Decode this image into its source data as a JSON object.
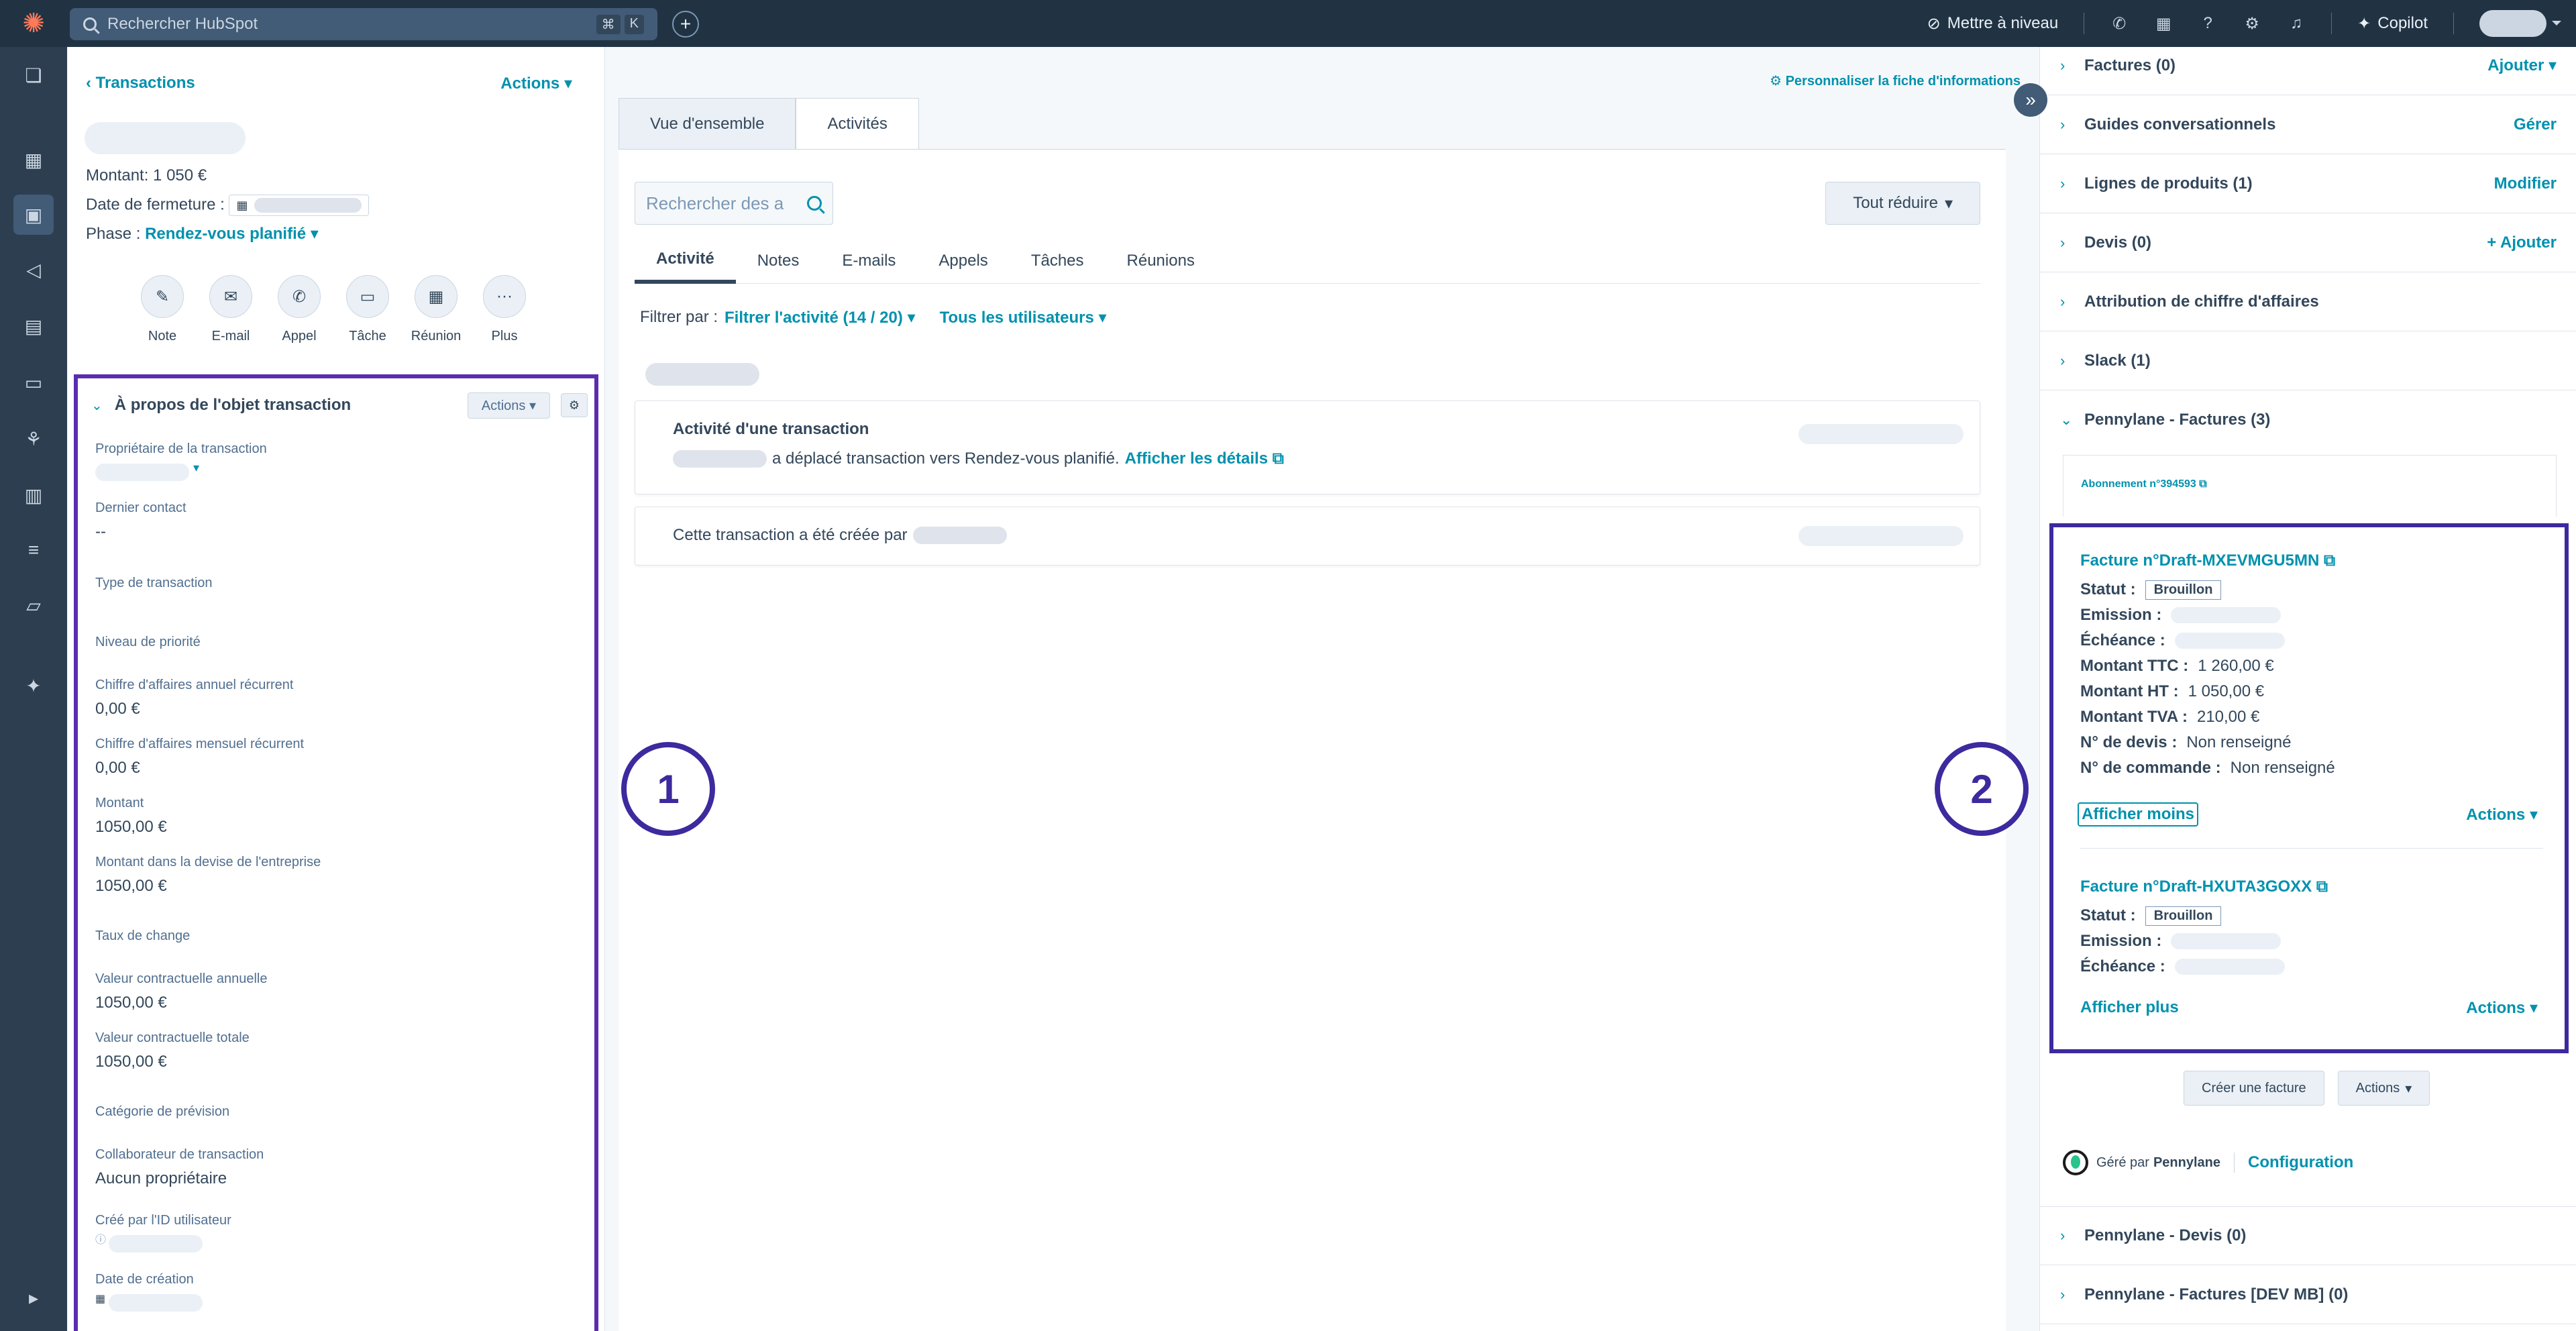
{
  "topbar": {
    "search_placeholder": "Rechercher HubSpot",
    "kbd_1": "⌘",
    "kbd_2": "K",
    "upgrade": "Mettre à niveau",
    "copilot": "Copilot"
  },
  "left": {
    "back": "Transactions",
    "actions": "Actions",
    "amount": "Montant: 1 050 €",
    "close_date_label": "Date de fermeture :",
    "phase_label": "Phase :",
    "phase_value": "Rendez-vous planifié",
    "quick_actions": {
      "note": "Note",
      "email": "E-mail",
      "call": "Appel",
      "task": "Tâche",
      "meeting": "Réunion",
      "more": "Plus"
    },
    "about": {
      "title": "À propos de l'objet transaction",
      "actions": "Actions",
      "props": [
        {
          "label": "Propriétaire de la transaction",
          "value": ""
        },
        {
          "label": "Dernier contact",
          "value": "--"
        },
        {
          "label": "Type de transaction",
          "value": ""
        },
        {
          "label": "Niveau de priorité",
          "value": ""
        },
        {
          "label": "Chiffre d'affaires annuel récurrent",
          "value": "0,00 €"
        },
        {
          "label": "Chiffre d'affaires mensuel récurrent",
          "value": "0,00 €"
        },
        {
          "label": "Montant",
          "value": "1050,00 €"
        },
        {
          "label": "Montant dans la devise de l'entreprise",
          "value": "1050,00 €"
        },
        {
          "label": "Taux de change",
          "value": ""
        },
        {
          "label": "Valeur contractuelle annuelle",
          "value": "1050,00 €"
        },
        {
          "label": "Valeur contractuelle totale",
          "value": "1050,00 €"
        },
        {
          "label": "Catégorie de prévision",
          "value": ""
        },
        {
          "label": "Collaborateur de transaction",
          "value": "Aucun propriétaire"
        },
        {
          "label": "Créé par l'ID utilisateur",
          "value": ""
        },
        {
          "label": "Date de création",
          "value": ""
        }
      ]
    }
  },
  "badges": {
    "one": "1",
    "two": "2"
  },
  "middle": {
    "personalize": "Personnaliser la fiche d'informations",
    "tabs": [
      "Vue d'ensemble",
      "Activités"
    ],
    "search_placeholder": "Rechercher des a",
    "reduce_all": "Tout réduire",
    "sub_tabs": [
      "Activité",
      "Notes",
      "E-mails",
      "Appels",
      "Tâches",
      "Réunions"
    ],
    "filter_label": "Filtrer par :",
    "filter_activity": "Filtrer l'activité (14 / 20)",
    "filter_users": "Tous les utilisateurs",
    "card1_title": "Activité d'une transaction",
    "card1_text": "a déplacé transaction vers Rendez-vous planifié.",
    "card1_link": "Afficher les détails",
    "card2_text": "Cette transaction a été créée par"
  },
  "right": {
    "sections": [
      {
        "title": "Factures (0)",
        "action": "Ajouter"
      },
      {
        "title": "Guides conversationnels",
        "action": "Gérer"
      },
      {
        "title": "Lignes de produits (1)",
        "action": "Modifier"
      },
      {
        "title": "Devis (0)",
        "action": "+ Ajouter"
      },
      {
        "title": "Attribution de chiffre d'affaires",
        "action": ""
      },
      {
        "title": "Slack (1)",
        "action": ""
      },
      {
        "title": "Pennylane - Factures (3)",
        "action": ""
      }
    ],
    "subscription": "Abonnement n°394593",
    "invoice1": {
      "title": "Facture n°Draft-MXEVMGU5MN",
      "status_label": "Statut :",
      "status": "Brouillon",
      "emission_label": "Emission :",
      "due_label": "Échéance :",
      "ttc_label": "Montant TTC :",
      "ttc": "1 260,00 €",
      "ht_label": "Montant HT :",
      "ht": "1 050,00 €",
      "tva_label": "Montant TVA :",
      "tva": "210,00 €",
      "quote_label": "N° de devis :",
      "quote": "Non renseigné",
      "order_label": "N° de commande :",
      "order": "Non renseigné",
      "show_less": "Afficher moins",
      "actions": "Actions"
    },
    "invoice2": {
      "title": "Facture n°Draft-HXUTA3GOXX",
      "status_label": "Statut :",
      "status": "Brouillon",
      "emission_label": "Emission :",
      "due_label": "Échéance :",
      "show_more": "Afficher plus",
      "actions": "Actions"
    },
    "create_invoice": "Créer une facture",
    "actions": "Actions",
    "managed_by": "Géré par",
    "managed_brand": "Pennylane",
    "configuration": "Configuration",
    "bottom_sections": [
      {
        "title": "Pennylane - Devis (0)"
      },
      {
        "title": "Pennylane - Factures [DEV MB] (0)"
      }
    ]
  },
  "colors": {
    "accent": "#0091ae",
    "highlight": "#3c2a9e",
    "topbar": "#213343"
  }
}
